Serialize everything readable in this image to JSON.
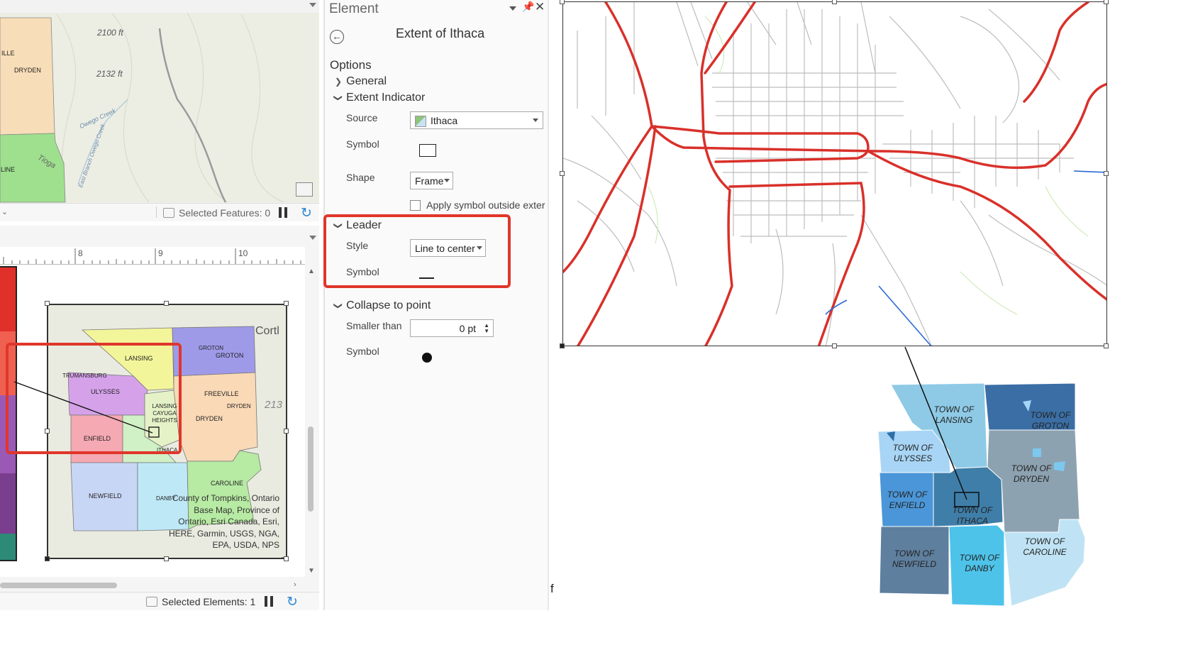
{
  "top_map_view": {
    "labels": [
      "2100 ft",
      "2132 ft",
      "DRYDEN",
      "ILLE",
      "LINE",
      "Owego Creek",
      "Tioga",
      "East Branch Owego Creek"
    ],
    "status": "Selected Features: 0"
  },
  "layout_view": {
    "ruler_ticks": [
      "8",
      "9",
      "10"
    ],
    "status": "Selected Elements: 1",
    "map_labels": [
      "LANSING",
      "TRUMANSBURG",
      "ULYSSES",
      "ENFIELD",
      "ITHACA",
      "NEWFIELD",
      "DANBY",
      "CAROLINE",
      "DRYDEN",
      "FREEVILLE",
      "GROTON",
      "GROTON",
      "LANSING CAYUGA HEIGHTS",
      "DRYDEN",
      "Cortl",
      "213"
    ],
    "attribution": "County of Tompkins, Ontario Base Map, Province of Ontario, Esri Canada, Esri, HERE, Garmin, USGS, NGA, EPA, USDA, NPS"
  },
  "element_pane": {
    "pane_title": "Element",
    "element_name": "Extent of Ithaca",
    "options_heading": "Options",
    "sections": {
      "general": "General",
      "extent_indicator": "Extent Indicator",
      "leader": "Leader",
      "collapse": "Collapse to point"
    },
    "extent": {
      "source_label": "Source",
      "source_value": "Ithaca",
      "symbol_label": "Symbol",
      "shape_label": "Shape",
      "shape_value": "Frame",
      "apply_label": "Apply symbol outside exter"
    },
    "leader": {
      "style_label": "Style",
      "style_value": "Line to center",
      "symbol_label": "Symbol"
    },
    "collapse": {
      "smaller_label": "Smaller than",
      "smaller_value": "0 pt",
      "symbol_label": "Symbol"
    }
  },
  "inset_map": {
    "towns": [
      "TOWN OF LANSING",
      "TOWN OF GROTON",
      "TOWN OF ULYSSES",
      "TOWN OF DRYDEN",
      "TOWN OF ENFIELD",
      "TOWN OF ITHACA",
      "TOWN OF NEWFIELD",
      "TOWN OF DANBY",
      "TOWN OF CAROLINE"
    ]
  },
  "bottom_fragment": "f",
  "colors": {
    "highlight": "#e0362a",
    "road": "#d9302a",
    "street": "#bdbdbd"
  }
}
